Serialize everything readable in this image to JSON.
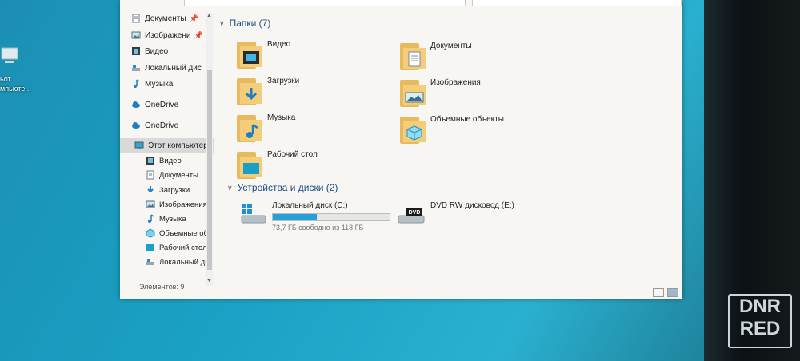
{
  "desktop": {
    "label_line1": "ьот",
    "label_line2": "мпьюте..."
  },
  "sidebar": {
    "items": [
      {
        "label": "Документы",
        "icon": "document-icon",
        "pinned": true
      },
      {
        "label": "Изображени",
        "icon": "pictures-icon",
        "pinned": true
      },
      {
        "label": "Видео",
        "icon": "video-icon",
        "pinned": false
      },
      {
        "label": "Локальный дис",
        "icon": "drive-icon",
        "pinned": false
      },
      {
        "label": "Музыка",
        "icon": "music-icon",
        "pinned": false
      },
      {
        "label": "OneDrive",
        "icon": "onedrive-icon"
      },
      {
        "label": "OneDrive",
        "icon": "onedrive-icon"
      },
      {
        "label": "Этот компьютер",
        "icon": "computer-icon",
        "selected": true
      },
      {
        "label": "Видео",
        "icon": "video-icon"
      },
      {
        "label": "Документы",
        "icon": "document-icon"
      },
      {
        "label": "Загрузки",
        "icon": "downloads-icon"
      },
      {
        "label": "Изображения",
        "icon": "pictures-icon"
      },
      {
        "label": "Музыка",
        "icon": "music-icon"
      },
      {
        "label": "Объемные объ",
        "icon": "3d-objects-icon"
      },
      {
        "label": "Рабочий стол",
        "icon": "desktop-icon"
      },
      {
        "label": "Локальный дис",
        "icon": "drive-icon"
      }
    ]
  },
  "status": {
    "items_count": "Элементов: 9"
  },
  "folders_group": {
    "title": "Папки (7)",
    "items": [
      {
        "label": "Видео",
        "icon": "video-folder-icon"
      },
      {
        "label": "Документы",
        "icon": "documents-folder-icon"
      },
      {
        "label": "Загрузки",
        "icon": "downloads-folder-icon"
      },
      {
        "label": "Изображения",
        "icon": "pictures-folder-icon"
      },
      {
        "label": "Музыка",
        "icon": "music-folder-icon"
      },
      {
        "label": "Объемные объекты",
        "icon": "3d-objects-folder-icon"
      },
      {
        "label": "Рабочий стол",
        "icon": "desktop-folder-icon"
      }
    ]
  },
  "devices_group": {
    "title": "Устройства и диски (2)",
    "drives": [
      {
        "label": "Локальный диск (C:)",
        "free_text": "73,7 ГБ свободно из 118 ГБ",
        "used_fraction": 0.38
      },
      {
        "label": "DVD RW дисковод (E:)",
        "badge": "DVD"
      }
    ]
  },
  "watermark": {
    "line1": "DNR",
    "line2": "RED"
  },
  "colors": {
    "accent": "#26a0da",
    "group_title": "#1c4b86",
    "folder": "#f3cd7a"
  }
}
